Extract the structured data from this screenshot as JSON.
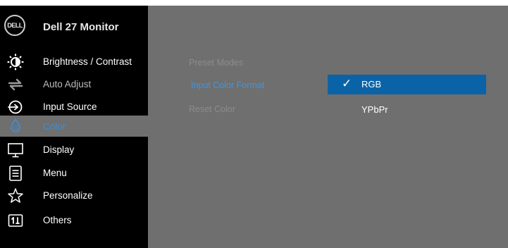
{
  "app": {
    "logo_text": "DELL",
    "title": "Dell 27 Monitor"
  },
  "sidebar": {
    "items": [
      {
        "label": "Brightness / Contrast",
        "icon": "brightness-icon"
      },
      {
        "label": "Auto Adjust",
        "icon": "auto-adjust-icon"
      },
      {
        "label": "Input Source",
        "icon": "input-source-icon"
      },
      {
        "label": "Color",
        "icon": "color-palette-icon"
      },
      {
        "label": "Display",
        "icon": "display-icon"
      },
      {
        "label": "Menu",
        "icon": "menu-icon"
      },
      {
        "label": "Personalize",
        "icon": "star-icon"
      },
      {
        "label": "Others",
        "icon": "others-icon"
      }
    ],
    "active_item": "Color"
  },
  "submenu": {
    "items": [
      {
        "label": "Preset Modes",
        "state": "dim"
      },
      {
        "label": "Input Color Format",
        "state": "selected"
      },
      {
        "label": "Reset Color",
        "state": "dim"
      }
    ]
  },
  "options": {
    "items": [
      {
        "label": "RGB",
        "checked": true
      },
      {
        "label": "YPbPr",
        "checked": false
      }
    ],
    "check_glyph": "✓"
  },
  "colors": {
    "sidebar_bg": "#000000",
    "panel_bg": "#6f6f6f",
    "accent": "#3b8fd8",
    "selection_bg": "#0b63a7"
  }
}
